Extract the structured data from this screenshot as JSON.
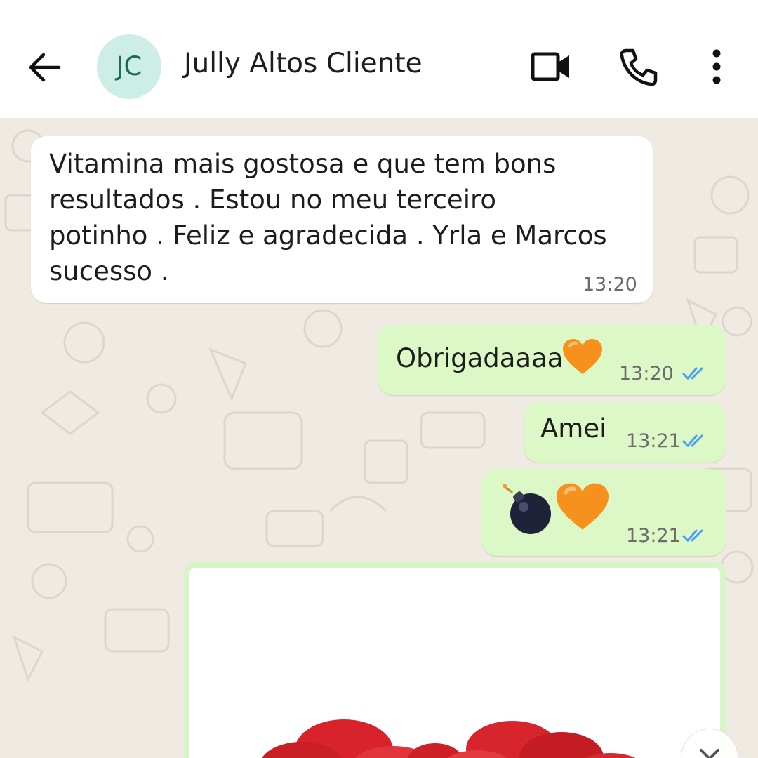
{
  "header": {
    "avatar_initials": "JC",
    "contact_name": "Jully Altos Cliente",
    "icons": {
      "back": "arrow-left-icon",
      "video": "video-call-icon",
      "call": "phone-icon",
      "menu": "more-vertical-icon"
    }
  },
  "messages": [
    {
      "direction": "incoming",
      "lines": [
        "Vitamina mais gostosa e que tem bons",
        "resultados . Estou no meu terceiro",
        "potinho . Feliz e agradecida . Yrla e Marcos",
        "sucesso ."
      ],
      "time": "13:20"
    },
    {
      "direction": "outgoing",
      "text": "Obrigadaaaa",
      "emoji": "orange-heart",
      "time": "13:20",
      "status": "read"
    },
    {
      "direction": "outgoing",
      "text": "Amei",
      "time": "13:21",
      "status": "read"
    },
    {
      "direction": "outgoing",
      "emojis": [
        "bomb",
        "orange-heart"
      ],
      "time": "13:21",
      "status": "read"
    },
    {
      "direction": "outgoing",
      "type": "image",
      "content": "rose-petals-image"
    }
  ],
  "colors": {
    "header_bg": "#ffffff",
    "chat_bg": "#efeae2",
    "incoming_bubble": "#ffffff",
    "outgoing_bubble": "#dcf8c6",
    "read_ticks": "#4a9ff5",
    "avatar_bg": "#cdeee6",
    "avatar_text": "#1b6b57"
  }
}
